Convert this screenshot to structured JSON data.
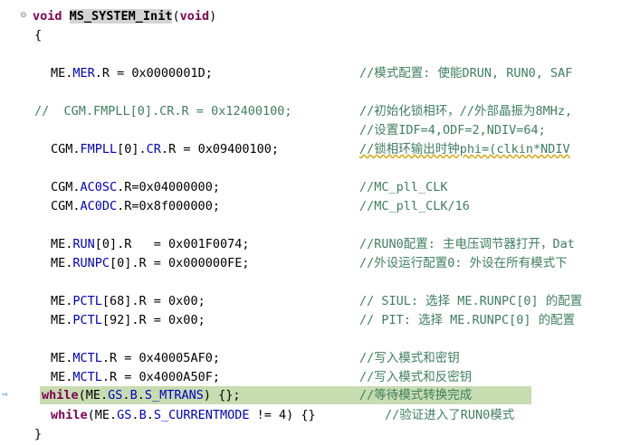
{
  "editor": {
    "function_name": "MS_SYSTEM_Init",
    "lines": [
      {
        "code": "",
        "comment": ""
      },
      {
        "code": "{",
        "comment": ""
      },
      {
        "code": "ME.MER.R = 0x0000001D;",
        "comment": "//模式配置: 使能DRUN, RUN0, SAF"
      },
      {
        "code": "//  CGM.FMPLL[0].CR.R = 0x12400100;",
        "comment": "//初始化锁相环，//外部晶振为8MHz,"
      },
      {
        "code": "",
        "comment": "//设置IDF=4,ODF=2,NDIV=64;"
      },
      {
        "code": "CGM.FMPLL[0].CR.R = 0x09400100;",
        "comment": "//锁相环输出时钟phi=(clkin*NDIV"
      },
      {
        "code": "CGM.AC0SC.R=0x04000000;",
        "comment": "//MC_pll_CLK"
      },
      {
        "code": "CGM.AC0DC.R=0x8f000000;",
        "comment": "//MC_pll_CLK/16"
      },
      {
        "code": "ME.RUN[0].R   = 0x001F0074;",
        "comment": "//RUN0配置: 主电压调节器打开，Dat"
      },
      {
        "code": "ME.RUNPC[0].R = 0x000000FE;",
        "comment": "//外设运行配置0: 外设在所有模式下"
      },
      {
        "code": "ME.PCTL[68].R = 0x00;",
        "comment": "// SIUL: 选择 ME.RUNPC[0] 的配置"
      },
      {
        "code": "ME.PCTL[92].R = 0x00;",
        "comment": "// PIT: 选择 ME.RUNPC[0] 的配置"
      },
      {
        "code": "ME.MCTL.R = 0x40005AF0;",
        "comment": "//写入模式和密钥"
      },
      {
        "code": "ME.MCTL.R = 0x4000A50F;",
        "comment": "//写入模式和反密钥"
      },
      {
        "code": "while(ME.GS.B.S_MTRANS) {};",
        "comment": "//等待模式转换完成"
      },
      {
        "code": "while(ME.GS.B.S_CURRENTMODE != 4) {}",
        "comment": "//验证进入了RUN0模式"
      },
      {
        "code": "}",
        "comment": ""
      }
    ]
  },
  "tokens": {
    "void": "void",
    "paren_open": "(",
    "paren_close": ")",
    "while": "while"
  },
  "colors": {
    "keyword": "#7f0055",
    "field": "#0000c0",
    "comment": "#3f7f5f",
    "current_line": "#c7dcb1"
  },
  "icons": {
    "fold": "collapse-icon",
    "instruction_pointer": "current-line-arrow-icon"
  }
}
